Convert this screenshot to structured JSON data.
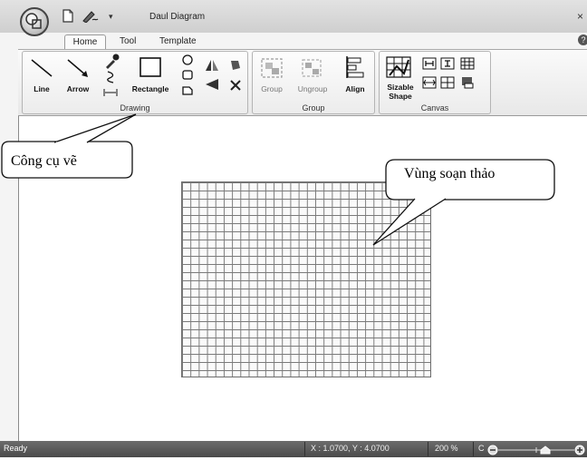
{
  "window": {
    "title": "Daul Diagram",
    "close_glyph": "×",
    "help_glyph": "?"
  },
  "quick_access": {
    "new_icon": "document-new-icon",
    "edit_icon": "pen-edit-icon",
    "dropdown_glyph": "▾"
  },
  "tabs": [
    {
      "label": "Home",
      "active": true
    },
    {
      "label": "Tool",
      "active": false
    },
    {
      "label": "Template",
      "active": false
    }
  ],
  "ribbon": {
    "drawing": {
      "label": "Drawing",
      "line": "Line",
      "arrow": "Arrow",
      "rectangle": "Rectangle"
    },
    "group": {
      "label": "Group",
      "group_btn": "Group",
      "ungroup_btn": "Ungroup",
      "align_btn": "Align"
    },
    "canvas": {
      "label": "Canvas",
      "sizable_line1": "Sizable",
      "sizable_line2": "Shape"
    }
  },
  "annotations": {
    "tools": "Công cụ vẽ",
    "editor": "Vùng soạn thảo"
  },
  "status": {
    "ready": "Ready",
    "coords": "X : 1.0700, Y : 4.0700",
    "zoom": "200 %",
    "zoom_prefix": "C"
  },
  "colors": {
    "status_bg": "#555555",
    "grid_line": "#7a7a7a",
    "ribbon_bg": "#ececec"
  }
}
